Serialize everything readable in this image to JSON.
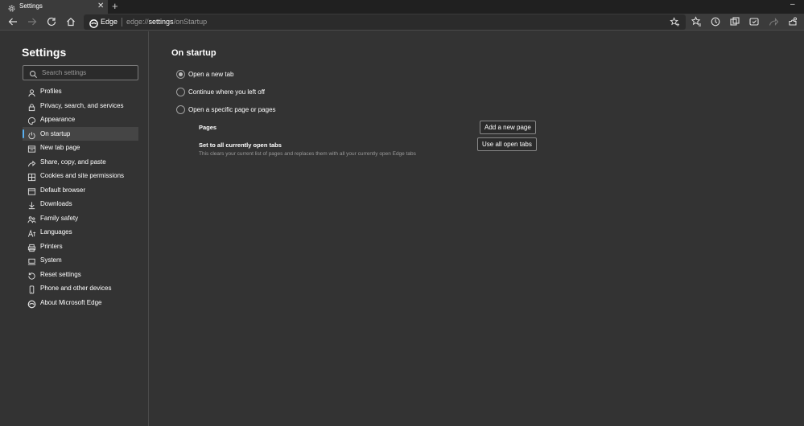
{
  "tab": {
    "title": "Settings",
    "close": "✕",
    "new_tab": "+"
  },
  "window": {
    "minimize": "–"
  },
  "address_bar": {
    "site_label": "Edge",
    "url_scheme": "edge://",
    "url_host": "settings",
    "url_path": "/onStartup"
  },
  "sidebar": {
    "title": "Settings",
    "search_placeholder": "Search settings",
    "items": [
      {
        "label": "Profiles",
        "icon": "profile-icon"
      },
      {
        "label": "Privacy, search, and services",
        "icon": "lock-icon"
      },
      {
        "label": "Appearance",
        "icon": "palette-icon"
      },
      {
        "label": "On startup",
        "icon": "power-icon",
        "active": true
      },
      {
        "label": "New tab page",
        "icon": "newtab-icon"
      },
      {
        "label": "Share, copy, and paste",
        "icon": "share-icon"
      },
      {
        "label": "Cookies and site permissions",
        "icon": "cookie-icon"
      },
      {
        "label": "Default browser",
        "icon": "browser-icon"
      },
      {
        "label": "Downloads",
        "icon": "download-icon"
      },
      {
        "label": "Family safety",
        "icon": "family-icon"
      },
      {
        "label": "Languages",
        "icon": "language-icon"
      },
      {
        "label": "Printers",
        "icon": "printer-icon"
      },
      {
        "label": "System",
        "icon": "laptop-icon"
      },
      {
        "label": "Reset settings",
        "icon": "reset-icon"
      },
      {
        "label": "Phone and other devices",
        "icon": "phone-icon"
      },
      {
        "label": "About Microsoft Edge",
        "icon": "edge-icon"
      }
    ]
  },
  "main": {
    "title": "On startup",
    "options": [
      {
        "label": "Open a new tab",
        "checked": true
      },
      {
        "label": "Continue where you left off",
        "checked": false
      },
      {
        "label": "Open a specific page or pages",
        "checked": false
      }
    ],
    "pages_label": "Pages",
    "add_page_button": "Add a new page",
    "set_tabs_label": "Set to all currently open tabs",
    "set_tabs_desc": "This clears your current list of pages and replaces them with all your currently open Edge tabs",
    "use_tabs_button": "Use all open tabs"
  },
  "colors": {
    "accent": "#5ab0f0",
    "background": "#333333",
    "tabbar": "#202020"
  }
}
